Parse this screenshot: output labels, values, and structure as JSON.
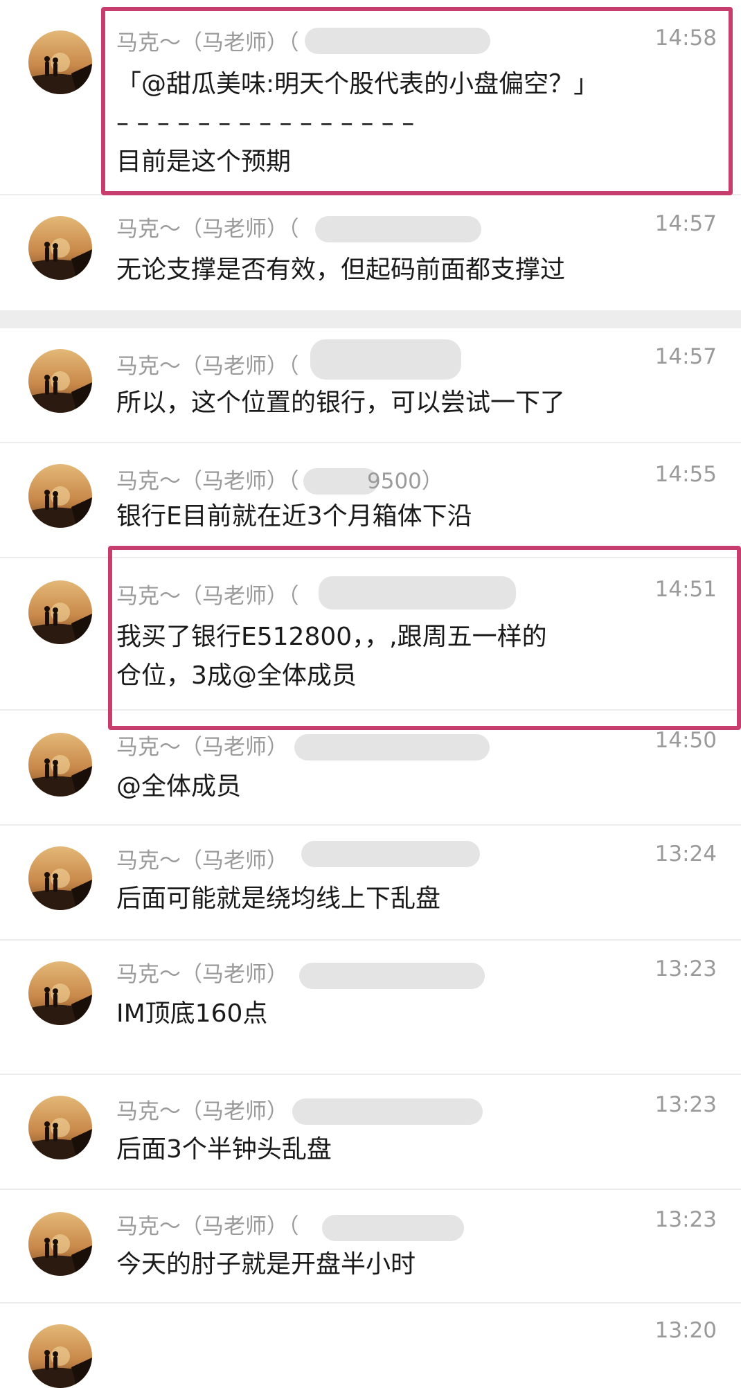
{
  "accent_color": "#c63d6e",
  "avatar_icon": "sunset-silhouette-avatar",
  "messages": [
    {
      "sender": "马克～（马老师）（",
      "time": "14:58",
      "text": "「@甜瓜美味:明天个股代表的小盘偏空？」\n– – – – – – – – – – – – – – –\n目前是这个预期"
    },
    {
      "sender": "马克～（马老师）（",
      "time": "14:57",
      "text": "无论支撑是否有效，但起码前面都支撑过"
    },
    {
      "sender": "马克～（马老师）（",
      "time": "14:57",
      "text": "所以，这个位置的银行，可以尝试一下了"
    },
    {
      "sender": "马克～（马老师）（",
      "sender_tail": "9500）",
      "time": "14:55",
      "text": "银行E目前就在近3个月箱体下沿"
    },
    {
      "sender": "马克～（马老师）（",
      "time": "14:51",
      "text": "我买了银行E512800，，,跟周五一样的\n仓位，3成@全体成员"
    },
    {
      "sender": "马克～（马老师）",
      "time": "14:50",
      "text": "@全体成员"
    },
    {
      "sender": "马克～（马老师）",
      "time": "13:24",
      "text": "后面可能就是绕均线上下乱盘"
    },
    {
      "sender": "马克～（马老师）",
      "time": "13:23",
      "text": "IM顶底160点"
    },
    {
      "sender": "马克～（马老师）",
      "time": "13:23",
      "text": "后面3个半钟头乱盘"
    },
    {
      "sender": "马克～（马老师）（",
      "time": "13:23",
      "text": "今天的肘子就是开盘半小时"
    },
    {
      "sender": "",
      "time": "13:20",
      "text": ""
    }
  ]
}
